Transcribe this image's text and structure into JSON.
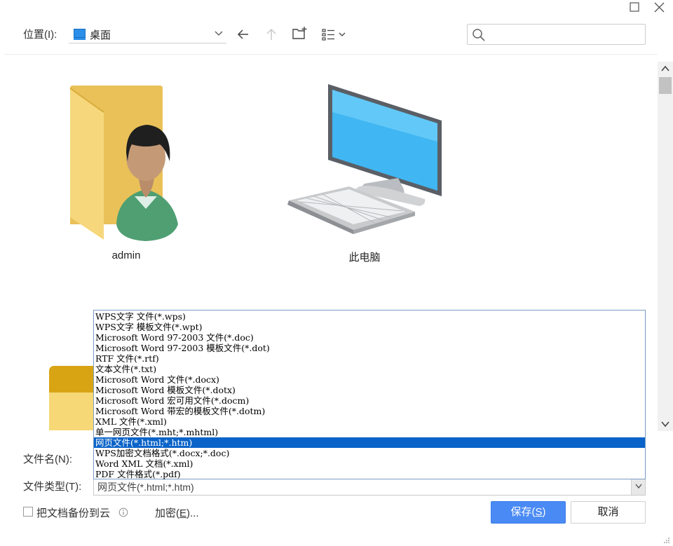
{
  "toolbar": {
    "location_label": "位置(I):",
    "location_value": "桌面",
    "search_placeholder": ""
  },
  "items": [
    {
      "label": "admin",
      "icon": "user-folder-icon"
    },
    {
      "label": "此电脑",
      "icon": "computer-icon"
    }
  ],
  "form": {
    "filename_label": "文件名(N):",
    "filetype_label": "文件类型(T):",
    "filetype_value": "网页文件(*.html;*.htm)"
  },
  "dropdown": {
    "options": [
      "WPS文字 文件(*.wps)",
      "WPS文字 模板文件(*.wpt)",
      "Microsoft Word 97-2003 文件(*.doc)",
      "Microsoft Word 97-2003 模板文件(*.dot)",
      "RTF 文件(*.rtf)",
      "文本文件(*.txt)",
      "Microsoft Word 文件(*.docx)",
      "Microsoft Word 模板文件(*.dotx)",
      "Microsoft Word 宏可用文件(*.docm)",
      "Microsoft Word 带宏的模板文件(*.dotm)",
      "XML 文件(*.xml)",
      "单一网页文件(*.mht;*.mhtml)",
      "网页文件(*.html;*.htm)",
      "WPS加密文档格式(*.docx;*.doc)",
      "Word XML 文档(*.xml)",
      "PDF 文件格式(*.pdf)"
    ],
    "selected_index": 12
  },
  "footer": {
    "backup_label": "把文档备份到云",
    "encrypt_label": "加密(E)...",
    "save_label": "保存(S)",
    "cancel_label": "取消"
  },
  "colors": {
    "accent": "#4a8af4",
    "selection": "#0a63c8"
  }
}
